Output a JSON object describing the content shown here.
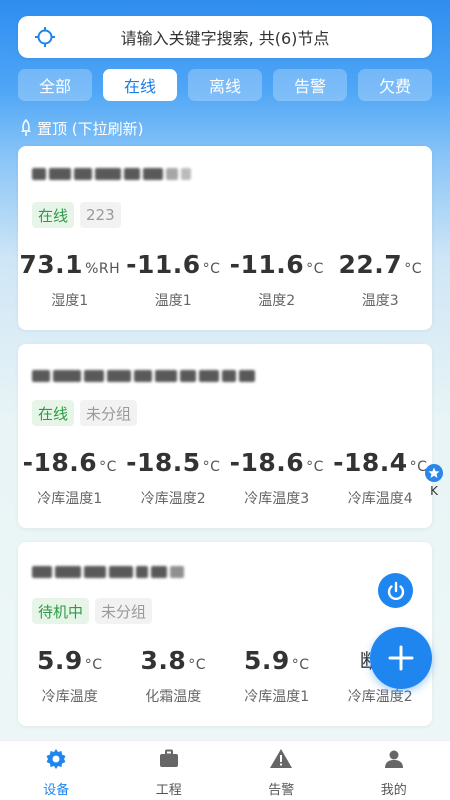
{
  "search": {
    "placeholder": "请输入关键字搜索, 共(6)节点"
  },
  "tabs": [
    {
      "label": "全部"
    },
    {
      "label": "在线"
    },
    {
      "label": "离线"
    },
    {
      "label": "告警"
    },
    {
      "label": "欠费"
    }
  ],
  "active_tab": "在线",
  "pin_hint": "置顶 (下拉刷新)",
  "cards": [
    {
      "tags": [
        "在线",
        "223"
      ],
      "metrics": [
        {
          "value": "73.1",
          "unit": "%RH",
          "label": "湿度1"
        },
        {
          "value": "-11.6",
          "unit": "°C",
          "label": "温度1"
        },
        {
          "value": "-11.6",
          "unit": "°C",
          "label": "温度2"
        },
        {
          "value": "22.7",
          "unit": "°C",
          "label": "温度3"
        }
      ]
    },
    {
      "tags": [
        "在线",
        "未分组"
      ],
      "metrics": [
        {
          "value": "-18.6",
          "unit": "°C",
          "label": "冷库温度1"
        },
        {
          "value": "-18.5",
          "unit": "°C",
          "label": "冷库温度2"
        },
        {
          "value": "-18.6",
          "unit": "°C",
          "label": "冷库温度3"
        },
        {
          "value": "-18.4",
          "unit": "°C",
          "label": "冷库温度4"
        }
      ]
    },
    {
      "tags": [
        "待机中",
        "未分组"
      ],
      "metrics": [
        {
          "value": "5.9",
          "unit": "°C",
          "label": "冷库温度"
        },
        {
          "value": "3.8",
          "unit": "°C",
          "label": "化霜温度"
        },
        {
          "value": "5.9",
          "unit": "°C",
          "label": "冷库温度1"
        },
        {
          "value": "断路",
          "unit": "",
          "label": "冷库温度2"
        }
      ]
    }
  ],
  "side_badge": {
    "label": "K"
  },
  "bottom_nav": [
    {
      "label": "设备",
      "icon": "gear-icon"
    },
    {
      "label": "工程",
      "icon": "briefcase-icon"
    },
    {
      "label": "告警",
      "icon": "warning-icon"
    },
    {
      "label": "我的",
      "icon": "user-icon"
    }
  ],
  "colors": {
    "accent": "#1e86ee",
    "online_tag": "#2e9a45",
    "online_tag_bg": "#e7f5e9"
  }
}
